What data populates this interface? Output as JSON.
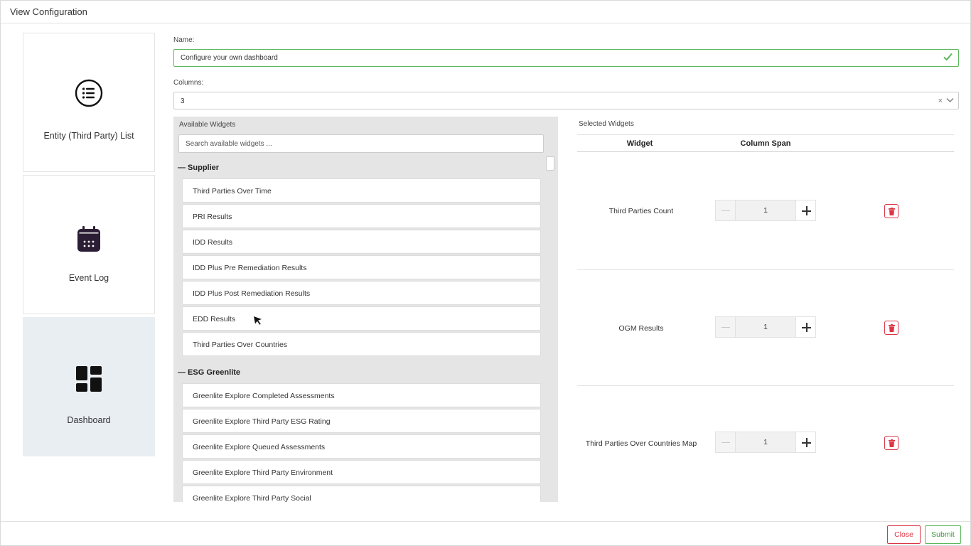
{
  "window": {
    "title": "View Configuration"
  },
  "views": [
    {
      "label": "Entity (Third Party) List",
      "icon": "list-icon",
      "active": false
    },
    {
      "label": "Event Log",
      "icon": "calendar-icon",
      "active": false
    },
    {
      "label": "Dashboard",
      "icon": "dashboard-icon",
      "active": true
    }
  ],
  "form": {
    "name_label": "Name:",
    "name_value": "Configure your own dashboard",
    "columns_label": "Columns:",
    "columns_value": "3",
    "clear_symbol": "×"
  },
  "available": {
    "title": "Available Widgets",
    "search_placeholder": "Search available widgets ...",
    "groups": [
      {
        "name": "— Supplier",
        "items": [
          "Third Parties Over Time",
          "PRI Results",
          "IDD Results",
          "IDD Plus Pre Remediation Results",
          "IDD Plus Post Remediation Results",
          "EDD Results",
          "Third Parties Over Countries"
        ]
      },
      {
        "name": "— ESG Greenlite",
        "items": [
          "Greenlite Explore Completed Assessments",
          "Greenlite Explore Third Party ESG Rating",
          "Greenlite Explore Queued Assessments",
          "Greenlite Explore Third Party Environment",
          "Greenlite Explore Third Party Social"
        ]
      }
    ]
  },
  "selected": {
    "title": "Selected Widgets",
    "col_widget": "Widget",
    "col_span": "Column Span",
    "rows": [
      {
        "name": "Third Parties Count",
        "span": "1"
      },
      {
        "name": "OGM Results",
        "span": "1"
      },
      {
        "name": "Third Parties Over Countries Map",
        "span": "1"
      }
    ]
  },
  "footer": {
    "close_label": "Close",
    "submit_label": "Submit"
  },
  "colors": {
    "success": "#5cb85c",
    "danger": "#dc3545",
    "active_view": "#e9eef2",
    "panel": "#e5e5e5",
    "icon_dark": "#2b1d33"
  }
}
